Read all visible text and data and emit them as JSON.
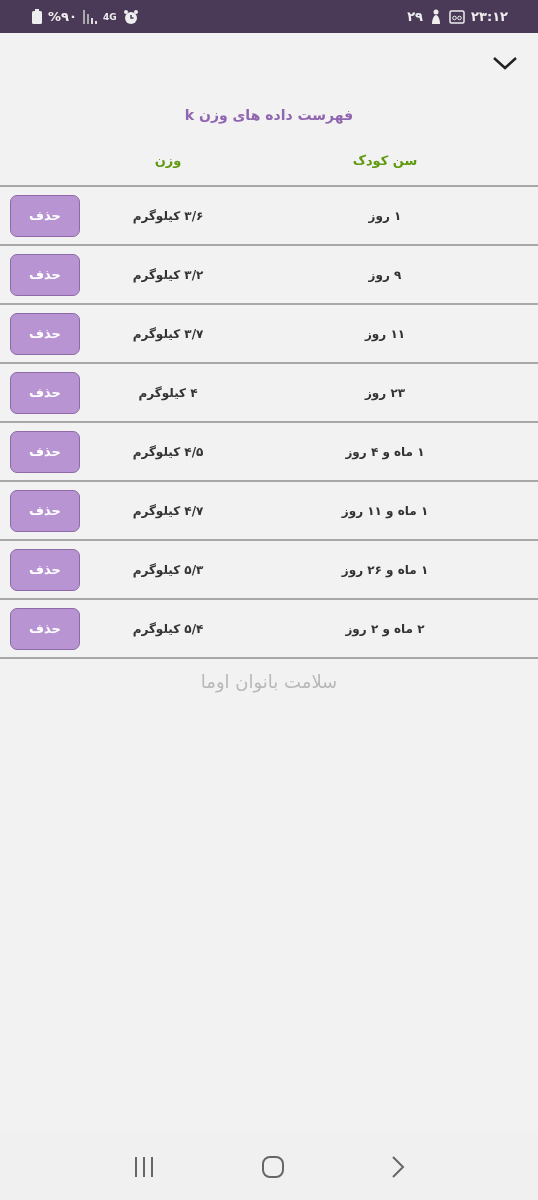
{
  "status_bar": {
    "battery": "%۹۰",
    "network": "4G",
    "date": "۲۹",
    "time": "۲۳:۱۲"
  },
  "title": "فهرست داده های وزن k",
  "columns": [
    "سن کودک",
    "وزن"
  ],
  "rows": [
    {
      "age": "۱ روز",
      "weight": "۳/۶ کیلوگرم",
      "action": "حذف"
    },
    {
      "age": "۹ روز",
      "weight": "۳/۲ کیلوگرم",
      "action": "حذف"
    },
    {
      "age": "۱۱ روز",
      "weight": "۳/۷ کیلوگرم",
      "action": "حذف"
    },
    {
      "age": "۲۳ روز",
      "weight": "۴ کیلوگرم",
      "action": "حذف"
    },
    {
      "age": "۱ ماه و ۴ روز",
      "weight": "۴/۵ کیلوگرم",
      "action": "حذف"
    },
    {
      "age": "۱ ماه و ۱۱ روز",
      "weight": "۴/۷ کیلوگرم",
      "action": "حذف"
    },
    {
      "age": "۱ ماه و ۲۶ روز",
      "weight": "۵/۳ کیلوگرم",
      "action": "حذف"
    },
    {
      "age": "۲ ماه و ۲ روز",
      "weight": "۵/۴ کیلوگرم",
      "action": "حذف"
    }
  ],
  "background_logo_text": "سلامت بانوان اوما"
}
